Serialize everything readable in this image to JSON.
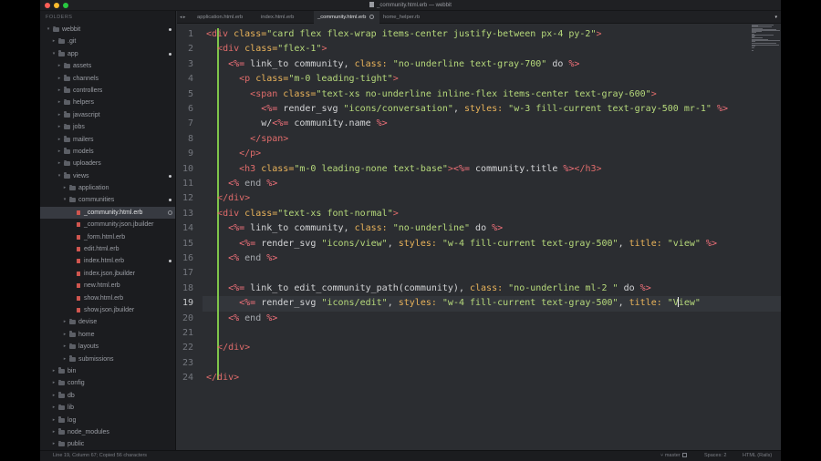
{
  "window": {
    "title": "_community.html.erb — webbit"
  },
  "sidebar": {
    "header": "FOLDERS",
    "items": [
      {
        "label": "webbit",
        "depth": 0,
        "kind": "folder",
        "open": true,
        "dot": true
      },
      {
        "label": ".git",
        "depth": 1,
        "kind": "folder",
        "open": false
      },
      {
        "label": "app",
        "depth": 1,
        "kind": "folder",
        "open": true,
        "dot": true
      },
      {
        "label": "assets",
        "depth": 2,
        "kind": "folder",
        "open": false
      },
      {
        "label": "channels",
        "depth": 2,
        "kind": "folder",
        "open": false
      },
      {
        "label": "controllers",
        "depth": 2,
        "kind": "folder",
        "open": false
      },
      {
        "label": "helpers",
        "depth": 2,
        "kind": "folder",
        "open": false
      },
      {
        "label": "javascript",
        "depth": 2,
        "kind": "folder",
        "open": false
      },
      {
        "label": "jobs",
        "depth": 2,
        "kind": "folder",
        "open": false
      },
      {
        "label": "mailers",
        "depth": 2,
        "kind": "folder",
        "open": false
      },
      {
        "label": "models",
        "depth": 2,
        "kind": "folder",
        "open": false
      },
      {
        "label": "uploaders",
        "depth": 2,
        "kind": "folder",
        "open": false
      },
      {
        "label": "views",
        "depth": 2,
        "kind": "folder",
        "open": true,
        "dot": true
      },
      {
        "label": "application",
        "depth": 3,
        "kind": "folder",
        "open": false
      },
      {
        "label": "communities",
        "depth": 3,
        "kind": "folder",
        "open": true,
        "dot": true
      },
      {
        "label": "_community.html.erb",
        "depth": 4,
        "kind": "file",
        "active": true,
        "odot": true
      },
      {
        "label": "_community.json.jbuilder",
        "depth": 4,
        "kind": "file"
      },
      {
        "label": "_form.html.erb",
        "depth": 4,
        "kind": "file"
      },
      {
        "label": "edit.html.erb",
        "depth": 4,
        "kind": "file"
      },
      {
        "label": "index.html.erb",
        "depth": 4,
        "kind": "file",
        "dot": true
      },
      {
        "label": "index.json.jbuilder",
        "depth": 4,
        "kind": "file"
      },
      {
        "label": "new.html.erb",
        "depth": 4,
        "kind": "file"
      },
      {
        "label": "show.html.erb",
        "depth": 4,
        "kind": "file"
      },
      {
        "label": "show.json.jbuilder",
        "depth": 4,
        "kind": "file"
      },
      {
        "label": "devise",
        "depth": 3,
        "kind": "folder",
        "open": false
      },
      {
        "label": "home",
        "depth": 3,
        "kind": "folder",
        "open": false
      },
      {
        "label": "layouts",
        "depth": 3,
        "kind": "folder",
        "open": false
      },
      {
        "label": "submissions",
        "depth": 3,
        "kind": "folder",
        "open": false
      },
      {
        "label": "bin",
        "depth": 1,
        "kind": "folder",
        "open": false
      },
      {
        "label": "config",
        "depth": 1,
        "kind": "folder",
        "open": false
      },
      {
        "label": "db",
        "depth": 1,
        "kind": "folder",
        "open": false
      },
      {
        "label": "lib",
        "depth": 1,
        "kind": "folder",
        "open": false
      },
      {
        "label": "log",
        "depth": 1,
        "kind": "folder",
        "open": false
      },
      {
        "label": "node_modules",
        "depth": 1,
        "kind": "folder",
        "open": false
      },
      {
        "label": "public",
        "depth": 1,
        "kind": "folder",
        "open": false
      }
    ]
  },
  "tabs": {
    "nav": "◂ ▸",
    "items": [
      {
        "label": "application.html.erb",
        "active": false
      },
      {
        "label": "index.html.erb",
        "active": false
      },
      {
        "label": "_community.html.erb",
        "active": true
      },
      {
        "label": "home_helper.rb",
        "active": false
      }
    ],
    "dropdown": "▾"
  },
  "editor": {
    "current_line": 19,
    "lines": [
      [
        [
          "t",
          "<div "
        ],
        [
          "a",
          "class="
        ],
        [
          "s",
          "\"card flex flex-wrap items-center justify-between px-4 py-2\""
        ],
        [
          "t",
          ">"
        ]
      ],
      [
        [
          "p",
          "  "
        ],
        [
          "t",
          "<div "
        ],
        [
          "a",
          "class="
        ],
        [
          "s",
          "\"flex-1\""
        ],
        [
          "t",
          ">"
        ]
      ],
      [
        [
          "p",
          "    "
        ],
        [
          "e",
          "<%="
        ],
        [
          "m",
          " link_to community, "
        ],
        [
          "a",
          "class: "
        ],
        [
          "s",
          "\"no-underline text-gray-700\""
        ],
        [
          "m",
          " do "
        ],
        [
          "e",
          "%>"
        ]
      ],
      [
        [
          "p",
          "      "
        ],
        [
          "t",
          "<p "
        ],
        [
          "a",
          "class="
        ],
        [
          "s",
          "\"m-0 leading-tight\""
        ],
        [
          "t",
          ">"
        ]
      ],
      [
        [
          "p",
          "        "
        ],
        [
          "t",
          "<span "
        ],
        [
          "a",
          "class="
        ],
        [
          "s",
          "\"text-xs no-underline inline-flex items-center text-gray-600\""
        ],
        [
          "t",
          ">"
        ]
      ],
      [
        [
          "p",
          "          "
        ],
        [
          "e",
          "<%="
        ],
        [
          "m",
          " render_svg "
        ],
        [
          "s",
          "\"icons/conversation\""
        ],
        [
          "m",
          ", "
        ],
        [
          "a",
          "styles: "
        ],
        [
          "s",
          "\"w-3 fill-current text-gray-500 mr-1\""
        ],
        [
          "m",
          " "
        ],
        [
          "e",
          "%>"
        ]
      ],
      [
        [
          "p",
          "          "
        ],
        [
          "m",
          "w/"
        ],
        [
          "e",
          "<%="
        ],
        [
          "m",
          " community.name "
        ],
        [
          "e",
          "%>"
        ]
      ],
      [
        [
          "p",
          "        "
        ],
        [
          "t",
          "</span>"
        ]
      ],
      [
        [
          "p",
          "      "
        ],
        [
          "t",
          "</p>"
        ]
      ],
      [
        [
          "p",
          "      "
        ],
        [
          "t",
          "<h3 "
        ],
        [
          "a",
          "class="
        ],
        [
          "s",
          "\"m-0 leading-none text-base\""
        ],
        [
          "t",
          ">"
        ],
        [
          "e",
          "<%="
        ],
        [
          "m",
          " community.title "
        ],
        [
          "e",
          "%>"
        ],
        [
          "t",
          "</h3>"
        ]
      ],
      [
        [
          "p",
          "    "
        ],
        [
          "e",
          "<%"
        ],
        [
          "k",
          " end "
        ],
        [
          "e",
          "%>"
        ]
      ],
      [
        [
          "p",
          "  "
        ],
        [
          "t",
          "</div>"
        ]
      ],
      [
        [
          "p",
          "  "
        ],
        [
          "t",
          "<div "
        ],
        [
          "a",
          "class="
        ],
        [
          "s",
          "\"text-xs font-normal\""
        ],
        [
          "t",
          ">"
        ]
      ],
      [
        [
          "p",
          "    "
        ],
        [
          "e",
          "<%="
        ],
        [
          "m",
          " link_to community, "
        ],
        [
          "a",
          "class: "
        ],
        [
          "s",
          "\"no-underline\""
        ],
        [
          "m",
          " do "
        ],
        [
          "e",
          "%>"
        ]
      ],
      [
        [
          "p",
          "      "
        ],
        [
          "e",
          "<%="
        ],
        [
          "m",
          " render_svg "
        ],
        [
          "s",
          "\"icons/view\""
        ],
        [
          "m",
          ", "
        ],
        [
          "a",
          "styles: "
        ],
        [
          "s",
          "\"w-4 fill-current text-gray-500\""
        ],
        [
          "m",
          ", "
        ],
        [
          "a",
          "title: "
        ],
        [
          "s",
          "\"view\""
        ],
        [
          "m",
          " "
        ],
        [
          "e",
          "%>"
        ]
      ],
      [
        [
          "p",
          "    "
        ],
        [
          "e",
          "<%"
        ],
        [
          "k",
          " end "
        ],
        [
          "e",
          "%>"
        ]
      ],
      [],
      [
        [
          "p",
          "    "
        ],
        [
          "e",
          "<%="
        ],
        [
          "m",
          " link_to edit_community_path(community), "
        ],
        [
          "a",
          "class: "
        ],
        [
          "s",
          "\"no-underline ml-2 \""
        ],
        [
          "m",
          " do "
        ],
        [
          "e",
          "%>"
        ]
      ],
      [
        [
          "p",
          "      "
        ],
        [
          "e",
          "<%="
        ],
        [
          "m",
          " render_svg "
        ],
        [
          "s",
          "\"icons/edit\""
        ],
        [
          "m",
          ", "
        ],
        [
          "a",
          "styles: "
        ],
        [
          "s",
          "\"w-4 fill-current text-gray-500\""
        ],
        [
          "m",
          ", "
        ],
        [
          "a",
          "title: "
        ],
        [
          "s",
          "\"V"
        ],
        [
          "caret",
          ""
        ],
        [
          "s",
          "iew\""
        ]
      ],
      [
        [
          "p",
          "    "
        ],
        [
          "e",
          "<%"
        ],
        [
          "k",
          " end "
        ],
        [
          "e",
          "%>"
        ]
      ],
      [],
      [
        [
          "p",
          "  "
        ],
        [
          "t",
          "</div>"
        ]
      ],
      [],
      [
        [
          "t",
          "</div>"
        ]
      ]
    ]
  },
  "status": {
    "left": "Line 19, Column 67; Copied 56 characters",
    "branch": "master",
    "spaces": "Spaces: 2",
    "syntax": "HTML (Rails)"
  }
}
